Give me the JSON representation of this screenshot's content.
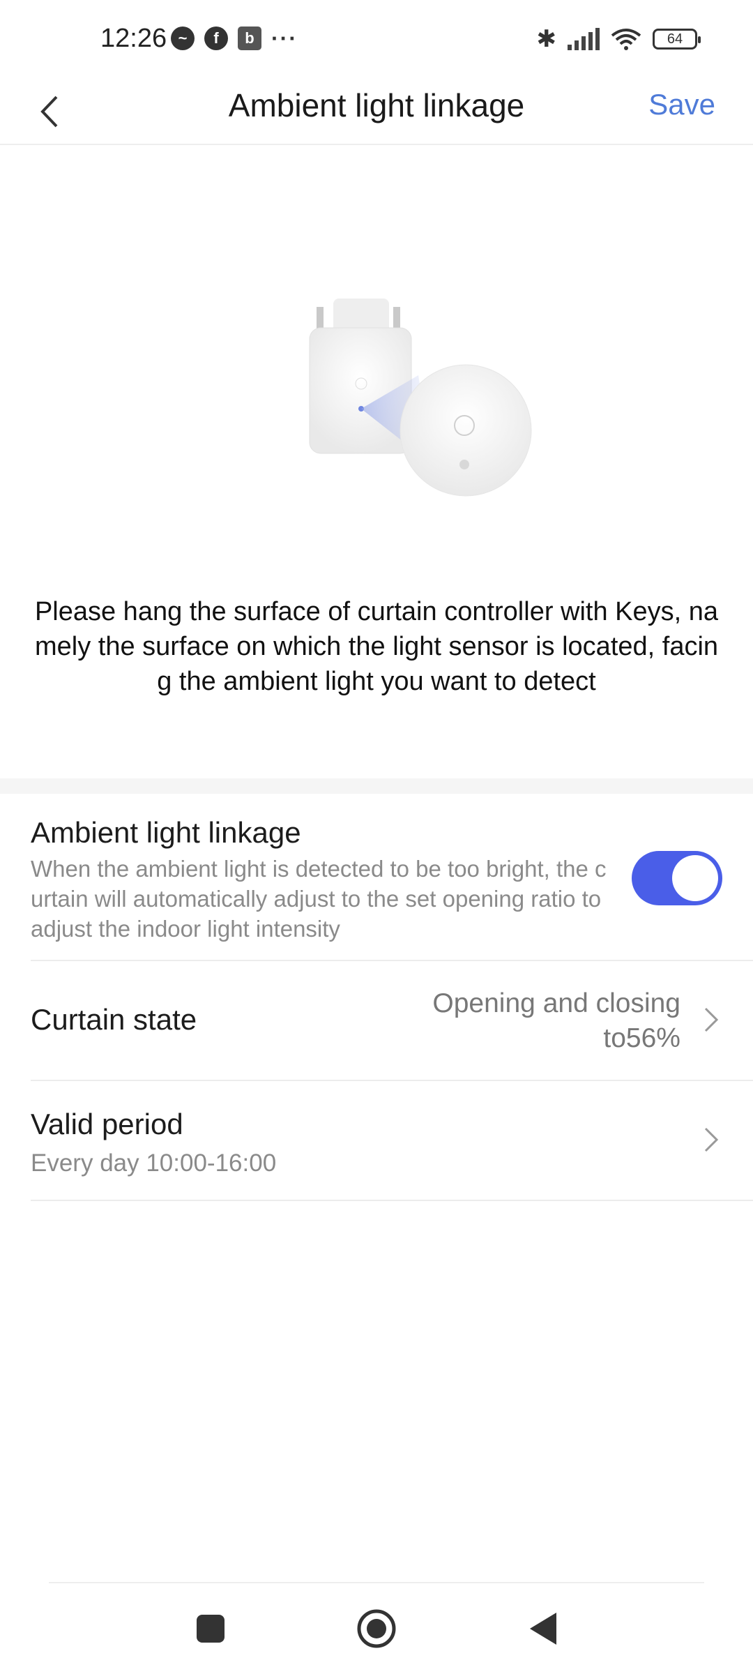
{
  "status_bar": {
    "time": "12:26",
    "notif_b": "b",
    "more": "···",
    "battery": "64"
  },
  "header": {
    "title": "Ambient light linkage",
    "save_label": "Save"
  },
  "instruction_text": "Please hang the surface of curtain controller with Keys, namely the surface on which the light sensor is located, facing the ambient light you want to detect",
  "settings": {
    "linkage": {
      "title": "Ambient light linkage",
      "description": "When the ambient light is detected to be too bright, the curtain will automatically adjust to the set opening ratio to adjust the indoor light intensity",
      "enabled": true
    },
    "curtain_state": {
      "title": "Curtain state",
      "value_line1": "Opening and closing",
      "value_line2": "to56%"
    },
    "valid_period": {
      "title": "Valid period",
      "value": "Every day 10:00-16:00"
    }
  },
  "colors": {
    "accent": "#4f7bd8",
    "toggle_on": "#4a5ee8"
  }
}
